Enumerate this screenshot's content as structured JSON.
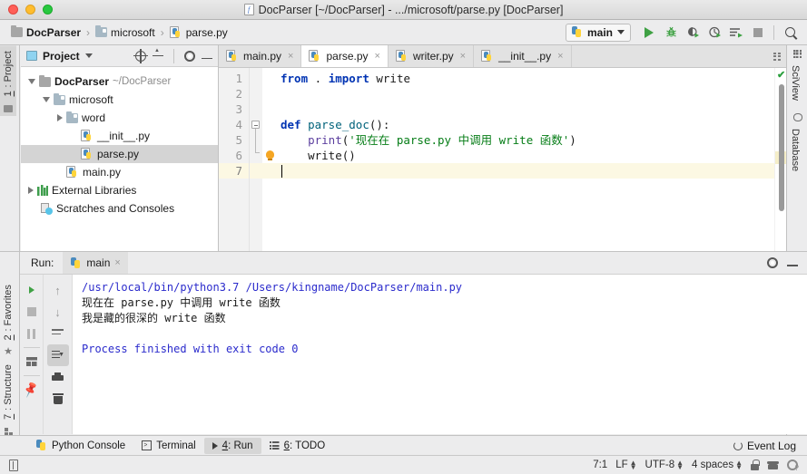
{
  "window": {
    "title": "DocParser [~/DocParser] - .../microsoft/parse.py [DocParser]",
    "title_icon": "python-file-icon"
  },
  "breadcrumb": {
    "items": [
      {
        "label": "DocParser",
        "icon": "folder-icon"
      },
      {
        "label": "microsoft",
        "icon": "source-folder-icon"
      },
      {
        "label": "parse.py",
        "icon": "python-file-icon"
      }
    ],
    "separator": "›"
  },
  "toolbar": {
    "run_config": {
      "label": "main",
      "icon": "python-icon"
    },
    "buttons": [
      {
        "name": "run-button",
        "icon": "run-triangle-icon"
      },
      {
        "name": "debug-button",
        "icon": "bug-icon"
      },
      {
        "name": "run-coverage-button",
        "icon": "coverage-icon"
      },
      {
        "name": "profile-button",
        "icon": "profiler-icon"
      },
      {
        "name": "run-with-console-button",
        "icon": "run-list-icon"
      },
      {
        "name": "stop-button",
        "icon": "stop-square-icon"
      },
      {
        "name": "search-everywhere-button",
        "icon": "search-icon"
      }
    ]
  },
  "left_rail": [
    {
      "label": "1: Project",
      "accel": "1",
      "rest": ": Project",
      "icon": "folder-icon",
      "active": true
    },
    {
      "label": "2: Favorites",
      "accel": "2",
      "rest": ": Favorites",
      "icon": "star-icon",
      "active": false
    },
    {
      "label": "7: Structure",
      "accel": "7",
      "rest": ": Structure",
      "icon": "structure-icon",
      "active": false
    }
  ],
  "right_rail": [
    {
      "label": "SciView",
      "icon": "grid-icon"
    },
    {
      "label": "Database",
      "icon": "database-icon"
    }
  ],
  "project_panel": {
    "title": "Project",
    "header_icons": [
      "target-icon",
      "collapse-all-icon",
      "gear-icon",
      "minimize-icon"
    ],
    "tree": [
      {
        "label": "DocParser",
        "path": "~/DocParser",
        "icon": "folder-icon",
        "arrow": "down",
        "indent": 0,
        "bold": true,
        "selected": false
      },
      {
        "label": "microsoft",
        "path": "",
        "icon": "source-folder-icon",
        "arrow": "down",
        "indent": 1,
        "bold": false,
        "selected": false
      },
      {
        "label": "word",
        "path": "",
        "icon": "source-folder-icon",
        "arrow": "right",
        "indent": 2,
        "bold": false,
        "selected": false
      },
      {
        "label": "__init__.py",
        "path": "",
        "icon": "python-file-icon",
        "arrow": "none",
        "indent": 3,
        "bold": false,
        "selected": false
      },
      {
        "label": "parse.py",
        "path": "",
        "icon": "python-file-icon",
        "arrow": "none",
        "indent": 3,
        "bold": false,
        "selected": true
      },
      {
        "label": "main.py",
        "path": "",
        "icon": "python-file-icon",
        "arrow": "none",
        "indent": 2,
        "bold": false,
        "selected": false
      },
      {
        "label": "External Libraries",
        "path": "",
        "icon": "library-icon",
        "arrow": "right",
        "indent": 0,
        "bold": false,
        "selected": false
      },
      {
        "label": "Scratches and Consoles",
        "path": "",
        "icon": "scratches-icon",
        "arrow": "none",
        "indent": 0,
        "bold": false,
        "selected": false
      }
    ]
  },
  "editor": {
    "tabs": [
      {
        "label": "main.py",
        "icon": "python-file-icon",
        "active": false
      },
      {
        "label": "parse.py",
        "icon": "python-file-icon",
        "active": true
      },
      {
        "label": "writer.py",
        "icon": "python-file-icon",
        "active": false
      },
      {
        "label": "__init__.py",
        "icon": "python-file-icon",
        "active": false
      }
    ],
    "close_glyph": "×",
    "line_numbers": [
      "1",
      "2",
      "3",
      "4",
      "5",
      "6",
      "7"
    ],
    "current_line": 7,
    "inspection_status": "ok",
    "check_glyph": "✔",
    "lines": [
      {
        "n": 1,
        "tokens": [
          {
            "t": "from",
            "c": "kw"
          },
          {
            "t": " . ",
            "c": "pl"
          },
          {
            "t": "import",
            "c": "kw"
          },
          {
            "t": " write",
            "c": "pl"
          }
        ]
      },
      {
        "n": 2,
        "tokens": []
      },
      {
        "n": 3,
        "tokens": []
      },
      {
        "n": 4,
        "tokens": [
          {
            "t": "def",
            "c": "kw"
          },
          {
            "t": " ",
            "c": "pl"
          },
          {
            "t": "parse_doc",
            "c": "fn"
          },
          {
            "t": "():",
            "c": "pl"
          }
        ]
      },
      {
        "n": 5,
        "tokens": [
          {
            "t": "    ",
            "c": "pl"
          },
          {
            "t": "print",
            "c": "bi"
          },
          {
            "t": "(",
            "c": "pl"
          },
          {
            "t": "'现在在 parse.py 中调用 write 函数'",
            "c": "str"
          },
          {
            "t": ")",
            "c": "pl"
          }
        ]
      },
      {
        "n": 6,
        "tokens": [
          {
            "t": "    write()",
            "c": "pl"
          }
        ]
      },
      {
        "n": 7,
        "tokens": []
      }
    ],
    "bulb_line": 6,
    "fold_lines": [
      4,
      6
    ]
  },
  "run_tool": {
    "label": "Run:",
    "tab": {
      "label": "main",
      "icon": "python-icon",
      "close_glyph": "×"
    },
    "header_icons": [
      "gear-icon",
      "minimize-icon"
    ],
    "sidebar_buttons": [
      {
        "name": "rerun-button",
        "icon": "run-triangle-icon"
      },
      {
        "name": "stop-button",
        "icon": "stop-square-icon"
      },
      {
        "name": "pause-button",
        "icon": "pause-icon"
      },
      {
        "name": "layout-button",
        "icon": "layout-icon"
      },
      {
        "name": "pin-tab-button",
        "icon": "pin-icon"
      }
    ],
    "sidebar2_buttons": [
      {
        "name": "up-button",
        "icon": "arrow-up-icon"
      },
      {
        "name": "down-button",
        "icon": "arrow-down-icon"
      },
      {
        "name": "soft-wrap-button",
        "icon": "wrap-icon"
      },
      {
        "name": "scroll-to-end-button",
        "icon": "scroll-end-icon",
        "active": true
      },
      {
        "name": "print-button",
        "icon": "print-icon"
      },
      {
        "name": "clear-all-button",
        "icon": "trash-icon"
      }
    ],
    "output": [
      {
        "text": "/usr/local/bin/python3.7 /Users/kingname/DocParser/main.py",
        "color": "blue"
      },
      {
        "text": "现在在 parse.py 中调用 write 函数",
        "color": "black"
      },
      {
        "text": "我是藏的很深的 write 函数",
        "color": "black"
      },
      {
        "text": "",
        "color": "black"
      },
      {
        "text": "Process finished with exit code 0",
        "color": "blue"
      }
    ]
  },
  "bottom_bar": {
    "items": [
      {
        "label": "Python Console",
        "accel": "",
        "rest": "Python Console",
        "icon": "python-icon",
        "active": false
      },
      {
        "label": "Terminal",
        "accel": "",
        "rest": "Terminal",
        "icon": "terminal-icon",
        "active": false
      },
      {
        "label": "4: Run",
        "accel": "4",
        "rest": ": Run",
        "icon": "run-triangle-icon",
        "active": true
      },
      {
        "label": "6: TODO",
        "accel": "6",
        "rest": ": TODO",
        "icon": "todo-icon",
        "active": false
      }
    ],
    "event_log": {
      "label": "Event Log",
      "icon": "event-log-icon"
    }
  },
  "status_bar": {
    "memory_icon": "book-icon",
    "caret_position": "7:1",
    "line_separator": "LF",
    "encoding": "UTF-8",
    "indent": "4 spaces",
    "icons": [
      "lock-icon",
      "hat-icon",
      "inspection-icon"
    ]
  },
  "colors": {
    "keyword": "#0033b3",
    "function": "#00627a",
    "builtin": "#5b3e9e",
    "string": "#067d17",
    "current_line": "#fcf8e3",
    "run_green": "#3fa144",
    "console_blue": "#2b2bcc",
    "selection": "#d4d4d4"
  }
}
